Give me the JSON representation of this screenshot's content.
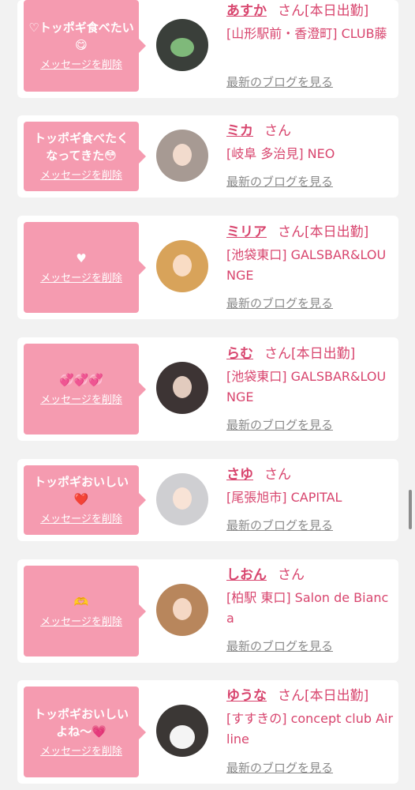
{
  "colors": {
    "bubble": "#f59bb0",
    "accent": "#d8456e",
    "blog_link": "#8a8a8a",
    "background": "#f2f2f2"
  },
  "delete_label": "メッセージを削除",
  "blog_label": "最新のブログを見る",
  "san_label": "さん",
  "messages": [
    {
      "message": "♡トッポギ食べたい😋",
      "name": "あすか",
      "status": "[本日出勤]",
      "shop": "[山形駅前・香澄町] CLUB藤",
      "avatar_color": "#3a3f3a",
      "avatar_icon": "frog-mask-icon"
    },
    {
      "message": "トッポギ食べたくなってきた😳",
      "name": "ミカ",
      "status": "",
      "shop": "[岐阜 多治見] NEO",
      "avatar_color": "#a79a93",
      "avatar_icon": "profile-photo"
    },
    {
      "message": "♥",
      "name": "ミリア",
      "status": "[本日出勤]",
      "shop": "[池袋東口] GALSBAR&LOUNGE",
      "avatar_color": "#d8a35a",
      "avatar_icon": "profile-photo"
    },
    {
      "message": "💞💞💞",
      "name": "らむ",
      "status": "[本日出勤]",
      "shop": "[池袋東口] GALSBAR&LOUNGE",
      "avatar_color": "#3d3434",
      "avatar_icon": "profile-photo"
    },
    {
      "message": "トッポギおいしい❤️",
      "name": "さゆ",
      "status": "",
      "shop": "[尾張旭市] CAPITAL",
      "avatar_color": "#cfcfd2",
      "avatar_icon": "profile-photo"
    },
    {
      "message": "🫶",
      "name": "しおん",
      "status": "",
      "shop": "[柏駅 東口] Salon de Bianca",
      "avatar_color": "#b8865c",
      "avatar_icon": "profile-photo"
    },
    {
      "message": "トッポギおいしいよね〜💗",
      "name": "ゆうな",
      "status": "[本日出勤]",
      "shop": "[すすきの] concept club Airline",
      "avatar_color": "#3b3735",
      "avatar_icon": "bunny-emoji-icon"
    }
  ]
}
